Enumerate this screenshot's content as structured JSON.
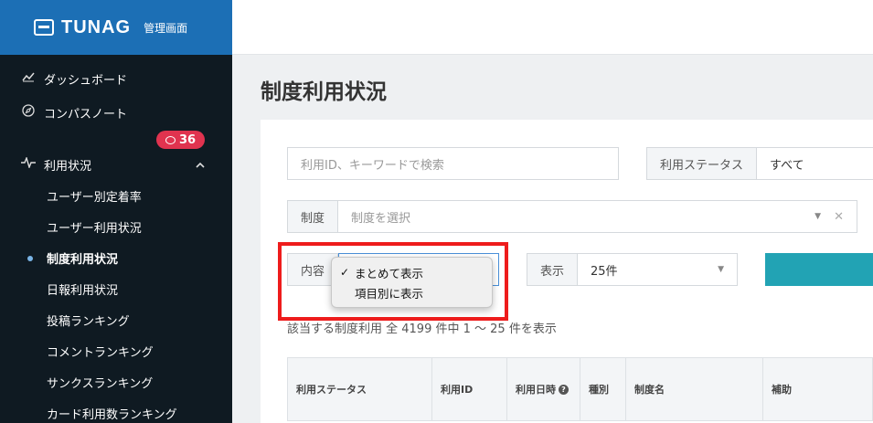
{
  "brand": {
    "name": "TUNAG",
    "sub": "管理画面"
  },
  "sidebar": {
    "items": [
      {
        "label": "ダッシュボード",
        "icon": "chart-icon"
      },
      {
        "label": "コンパスノート",
        "icon": "compass-icon"
      },
      {
        "label": "利用状況",
        "icon": "pulse-icon"
      }
    ],
    "badge_count": "36",
    "sub_items": [
      {
        "label": "ユーザー別定着率"
      },
      {
        "label": "ユーザー利用状況"
      },
      {
        "label": "制度利用状況"
      },
      {
        "label": "日報利用状況"
      },
      {
        "label": "投稿ランキング"
      },
      {
        "label": "コメントランキング"
      },
      {
        "label": "サンクスランキング"
      },
      {
        "label": "カード利用数ランキング"
      }
    ]
  },
  "page": {
    "title": "制度利用状況"
  },
  "filters": {
    "keyword_placeholder": "利用ID、キーワードで検索",
    "status_label": "利用ステータス",
    "status_value": "すべて",
    "system_label": "制度",
    "system_placeholder": "制度を選択",
    "content_label": "内容",
    "display_label": "表示",
    "display_value": "25件"
  },
  "dropdown": {
    "options": [
      {
        "label": "まとめて表示",
        "selected": true
      },
      {
        "label": "項目別に表示",
        "selected": false
      }
    ]
  },
  "result_text": "該当する制度利用 全 4199 件中 1 〜 25 件を表示",
  "table": {
    "columns": [
      "利用ステータス",
      "利用ID",
      "利用日時",
      "種別",
      "制度名",
      "補助"
    ]
  },
  "colors": {
    "brand": "#1c6fb5",
    "sidebar": "#0f1a22",
    "accent": "#22a3b4",
    "badge": "#e0334f",
    "highlight": "#ee1c1c"
  }
}
